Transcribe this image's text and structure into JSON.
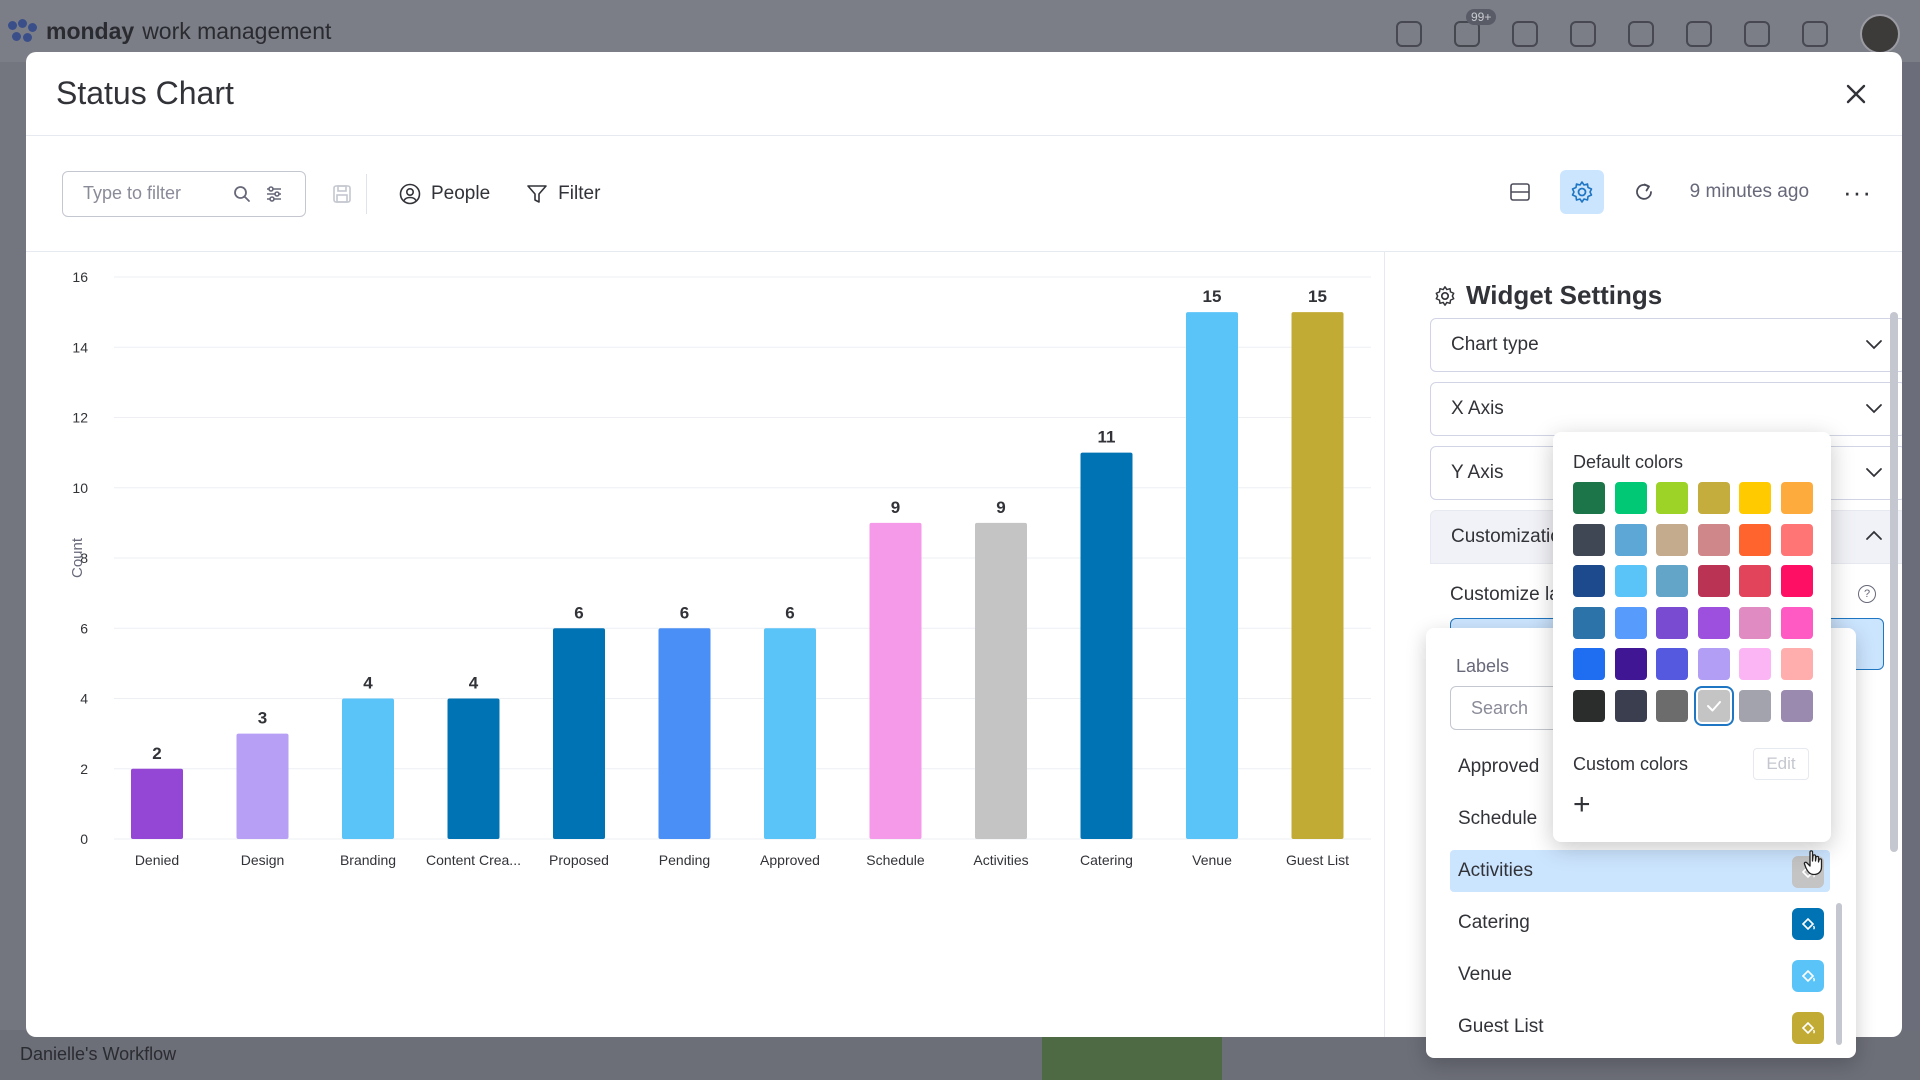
{
  "app": {
    "brand_bold": "monday",
    "brand_light": "work management",
    "notifications_badge": "99+",
    "workspace": "Danielle's Workflow"
  },
  "modal": {
    "title": "Status Chart"
  },
  "toolbar": {
    "filter_placeholder": "Type to filter",
    "people_label": "People",
    "filter_label": "Filter",
    "updated_text": "9 minutes ago",
    "more_label": "···"
  },
  "settings": {
    "title": "Widget Settings",
    "chart_type": "Chart type",
    "x_axis": "X Axis",
    "y_axis": "Y Axis",
    "customization": "Customization",
    "customize_labels": "Customize labe"
  },
  "labels_dropdown": {
    "header": "Labels",
    "search_placeholder": "Search",
    "items": [
      {
        "label": "Approved",
        "color": null
      },
      {
        "label": "Schedule",
        "color": null
      },
      {
        "label": "Activities",
        "color": "#c4c4c4"
      },
      {
        "label": "Catering",
        "color": "#0073b4"
      },
      {
        "label": "Venue",
        "color": "#5ac4f9"
      },
      {
        "label": "Guest List",
        "color": "#c2ab35"
      }
    ]
  },
  "color_picker": {
    "default_colors_label": "Default colors",
    "custom_colors_label": "Custom colors",
    "edit_label": "Edit",
    "add_label": "+",
    "selected_index": 33,
    "colors": [
      "#1b7548",
      "#00c875",
      "#9cd326",
      "#c4ad3d",
      "#ffcb00",
      "#fdab3d",
      "#3f4654",
      "#5ca7d6",
      "#c5ab8e",
      "#d0878a",
      "#ff642e",
      "#ff7575",
      "#1d4a8c",
      "#5ac4f9",
      "#63a5c9",
      "#bb3354",
      "#e2445c",
      "#ff0f64",
      "#2b73a9",
      "#579bfc",
      "#784bd1",
      "#9d50dd",
      "#e08bc2",
      "#ff5ac4",
      "#1f6ef1",
      "#401694",
      "#5559df",
      "#b39ef6",
      "#fbb4f4",
      "#ffadad",
      "#2b2c2c",
      "#3a3e4e",
      "#6c6c6c",
      "#c4c4c4",
      "#a2a3ad",
      "#9b8aaf"
    ]
  },
  "chart_data": {
    "type": "bar",
    "title": "",
    "xlabel": "",
    "ylabel": "Count",
    "ylim": [
      0,
      16
    ],
    "yticks": [
      0,
      2,
      4,
      6,
      8,
      10,
      12,
      14,
      16
    ],
    "grid": true,
    "categories": [
      "Denied",
      "Design",
      "Branding",
      "Content Crea...",
      "Proposed",
      "Pending",
      "Approved",
      "Schedule",
      "Activities",
      "Catering",
      "Venue",
      "Guest List"
    ],
    "values": [
      2,
      3,
      4,
      4,
      6,
      6,
      6,
      9,
      9,
      11,
      15,
      15
    ],
    "colors": [
      "#9446d5",
      "#b79ff5",
      "#5ac4f9",
      "#0073b4",
      "#0073b4",
      "#4a8ff5",
      "#5ac4f9",
      "#f59ae8",
      "#c4c4c4",
      "#0073b4",
      "#5ac4f9",
      "#c2ab35"
    ]
  }
}
